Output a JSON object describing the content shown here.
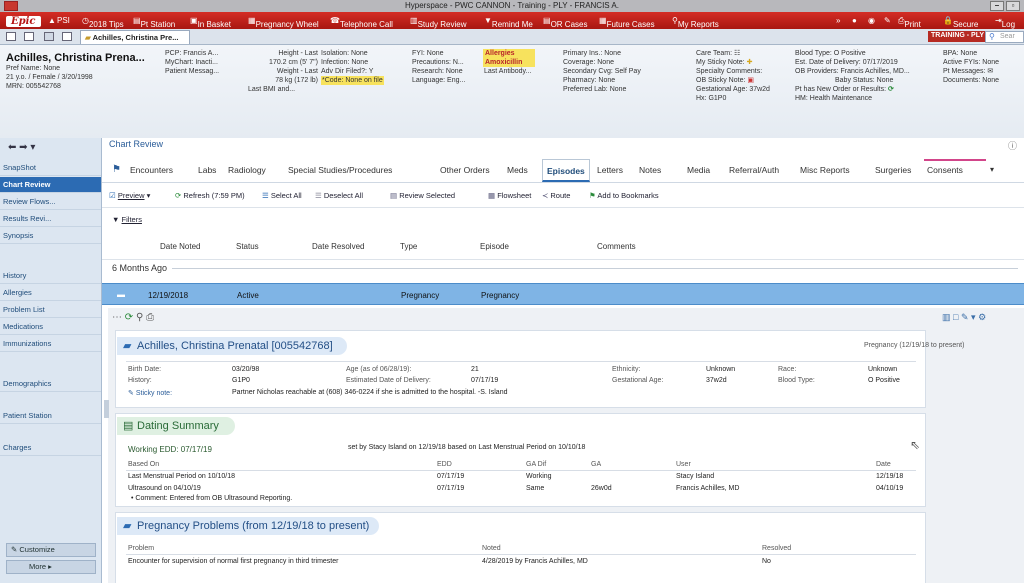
{
  "window": {
    "title": "Hyperspace - PWC CANNON - Training - PLY - FRANCIS A.",
    "min": "–",
    "max": "▫"
  },
  "toolbar": {
    "logo": "Epic",
    "items": [
      "PSI",
      "2018 Tips",
      "Pt Station",
      "In Basket",
      "Pregnancy Wheel",
      "Telephone Call",
      "Study Review",
      "Remind Me",
      "OR Cases",
      "Future Cases",
      "My Reports"
    ],
    "print": "Print",
    "secure": "Secure",
    "log": "Log"
  },
  "tabs": {
    "patient_tab": "Achilles, Christina Pre...",
    "env": "TRAINING - PLY",
    "search_placeholder": "Sear"
  },
  "patient": {
    "name": "Achilles, Christina Prena...",
    "pref": "Pref Name: None",
    "age": "21 y.o. / Female / 3/20/1998",
    "mrn": "MRN: 005542768",
    "pcp": "PCP: Francis A...",
    "mychart": "MyChart: Inacti...",
    "msg": "Patient Messag...",
    "height": "Height - Last",
    "height_val": "170.2 cm (5' 7\")",
    "weight": "Weight - Last",
    "weight_val": "78 kg (172 lb)",
    "bmi": "Last BMI and...",
    "isolation": "Isolation: None",
    "infection": "Infection: None",
    "advdir": "Adv Dir Filed?: Y",
    "code": "*Code: None on file",
    "fyi": "FYI: None",
    "precautions": "Precautions: N...",
    "research": "Research: None",
    "language": "Language: Eng...",
    "allergies": "Allergies",
    "amox": "Amoxicillin",
    "antibody": "Last Antibody...",
    "ins": "Primary Ins.: None",
    "coverage": "Coverage: None",
    "secondary": "Secondary Cvg: Self Pay",
    "pharmacy": "Pharmacy: None",
    "lab": "Preferred Lab: None",
    "careteam": "Care Team:",
    "sticky": "My Sticky Note:",
    "specialty": "Specialty Comments:",
    "obsticky": "OB Sticky Note:",
    "ga": "Gestational Age: 37w2d",
    "hx": "Hx: G1P0",
    "blood": "Blood Type: O Positive",
    "edd": "Est. Date of Delivery: 07/17/2019",
    "obprov": "OB Providers: Francis Achilles, MD...",
    "baby": "Baby Status: None",
    "neworder": "Pt has New Order or Results:",
    "hm": "HM: Health Maintenance",
    "bpa": "BPA: None",
    "fyis": "Active FYIs: None",
    "ptmsg": "Pt Messages:",
    "docs": "Documents: None"
  },
  "nav": {
    "items": [
      "SnapShot",
      "Chart Review",
      "Review Flows...",
      "Results Revi...",
      "Synopsis",
      "History",
      "Allergies",
      "Problem List",
      "Medications",
      "Immunizations",
      "Demographics",
      "Patient Station",
      "Charges"
    ],
    "customize": "Customize",
    "more": "More"
  },
  "chart": {
    "title": "Chart Review",
    "tabs": [
      "Encounters",
      "Labs",
      "Radiology",
      "Special Studies/Procedures",
      "Other Orders",
      "Meds",
      "Episodes",
      "Letters",
      "Notes",
      "Media",
      "Referral/Auth",
      "Misc Reports",
      "Surgeries",
      "Consents"
    ],
    "actions": [
      "Preview",
      "Refresh (7:59 PM)",
      "Select All",
      "Deselect All",
      "Review Selected",
      "Flowsheet",
      "Route",
      "Add to Bookmarks"
    ],
    "filters": "Filters",
    "columns": [
      "Date Noted",
      "Status",
      "Date Resolved",
      "Type",
      "Episode",
      "Comments"
    ],
    "group": "6 Months Ago",
    "row": {
      "date": "12/19/2018",
      "status": "Active",
      "type": "Pregnancy",
      "episode": "Pregnancy"
    }
  },
  "prenatal": {
    "title": "Achilles, Christina Prenatal [005542768]",
    "range": "Pregnancy (12/19/18 to present)",
    "birth_label": "Birth Date:",
    "birth": "03/20/98",
    "age_label": "Age (as of 06/28/19):",
    "age": "21",
    "eth_label": "Ethnicity:",
    "eth": "Unknown",
    "race_label": "Race:",
    "race": "Unknown",
    "history_label": "History:",
    "history": "G1P0",
    "edd_label": "Estimated Date of Delivery:",
    "edd": "07/17/19",
    "ga_label": "Gestational Age:",
    "ga": "37w2d",
    "blood_label": "Blood Type:",
    "blood": "O Positive",
    "sticky_label": "Sticky note:",
    "sticky": "Partner Nicholas reachable at (608) 346-0224 if she is admitted to the hospital. -S. Island"
  },
  "dating": {
    "title": "Dating Summary",
    "working": "Working EDD: 07/17/19",
    "setby": "set by Stacy Island on 12/19/18 based on Last Menstrual Period on 10/10/18",
    "headers": [
      "Based On",
      "EDD",
      "GA Dif",
      "GA",
      "User",
      "Date"
    ],
    "rows": [
      [
        "Last Menstrual Period on 10/10/18",
        "07/17/19",
        "Working",
        "",
        "Stacy Island",
        "12/19/18"
      ],
      [
        "Ultrasound on 04/10/19",
        "07/17/19",
        "Same",
        "26w0d",
        "Francis Achilles, MD",
        "04/10/19"
      ]
    ],
    "comment": "• Comment: Entered from OB Ultrasound Reporting."
  },
  "problems": {
    "title": "Pregnancy Problems (from 12/19/18 to present)",
    "headers": [
      "Problem",
      "Noted",
      "Resolved"
    ],
    "row": [
      "Encounter for supervision of normal first pregnancy in third trimester",
      "4/28/2019 by Francis Achilles, MD",
      "No"
    ]
  },
  "colors": {
    "red": "#c0221b",
    "blue": "#2c6bb3"
  }
}
